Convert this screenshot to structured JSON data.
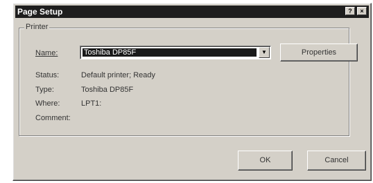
{
  "window": {
    "title": "Page Setup",
    "help_glyph": "?",
    "close_glyph": "×"
  },
  "printer": {
    "group_label": "Printer",
    "name_label": "Name:",
    "name_value": "Toshiba DP85F",
    "properties_label": "Properties",
    "status_label": "Status:",
    "status_value": "Default printer; Ready",
    "type_label": "Type:",
    "type_value": "Toshiba DP85F",
    "where_label": "Where:",
    "where_value": "LPT1:",
    "comment_label": "Comment:",
    "comment_value": ""
  },
  "buttons": {
    "ok": "OK",
    "cancel": "Cancel"
  },
  "icons": {
    "dropdown": "chevron-down-icon",
    "help": "help-icon",
    "close": "close-icon"
  },
  "colors": {
    "dialog_bg": "#d4d0c8",
    "titlebar_bg": "#1e1e1e",
    "selection_bg": "#1a1a1a"
  }
}
